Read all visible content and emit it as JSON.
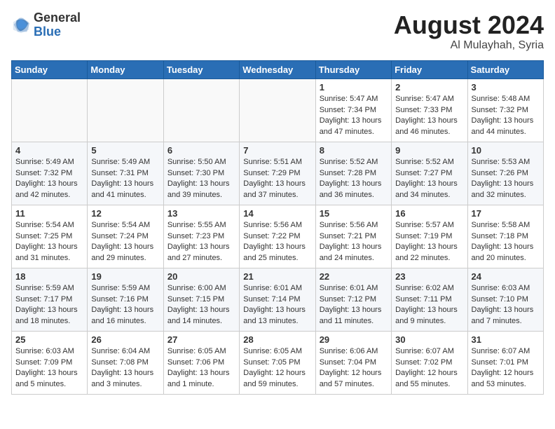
{
  "header": {
    "logo_general": "General",
    "logo_blue": "Blue",
    "month_year": "August 2024",
    "location": "Al Mulayhah, Syria"
  },
  "weekdays": [
    "Sunday",
    "Monday",
    "Tuesday",
    "Wednesday",
    "Thursday",
    "Friday",
    "Saturday"
  ],
  "weeks": [
    [
      {
        "day": "",
        "info": ""
      },
      {
        "day": "",
        "info": ""
      },
      {
        "day": "",
        "info": ""
      },
      {
        "day": "",
        "info": ""
      },
      {
        "day": "1",
        "info": "Sunrise: 5:47 AM\nSunset: 7:34 PM\nDaylight: 13 hours\nand 47 minutes."
      },
      {
        "day": "2",
        "info": "Sunrise: 5:47 AM\nSunset: 7:33 PM\nDaylight: 13 hours\nand 46 minutes."
      },
      {
        "day": "3",
        "info": "Sunrise: 5:48 AM\nSunset: 7:32 PM\nDaylight: 13 hours\nand 44 minutes."
      }
    ],
    [
      {
        "day": "4",
        "info": "Sunrise: 5:49 AM\nSunset: 7:32 PM\nDaylight: 13 hours\nand 42 minutes."
      },
      {
        "day": "5",
        "info": "Sunrise: 5:49 AM\nSunset: 7:31 PM\nDaylight: 13 hours\nand 41 minutes."
      },
      {
        "day": "6",
        "info": "Sunrise: 5:50 AM\nSunset: 7:30 PM\nDaylight: 13 hours\nand 39 minutes."
      },
      {
        "day": "7",
        "info": "Sunrise: 5:51 AM\nSunset: 7:29 PM\nDaylight: 13 hours\nand 37 minutes."
      },
      {
        "day": "8",
        "info": "Sunrise: 5:52 AM\nSunset: 7:28 PM\nDaylight: 13 hours\nand 36 minutes."
      },
      {
        "day": "9",
        "info": "Sunrise: 5:52 AM\nSunset: 7:27 PM\nDaylight: 13 hours\nand 34 minutes."
      },
      {
        "day": "10",
        "info": "Sunrise: 5:53 AM\nSunset: 7:26 PM\nDaylight: 13 hours\nand 32 minutes."
      }
    ],
    [
      {
        "day": "11",
        "info": "Sunrise: 5:54 AM\nSunset: 7:25 PM\nDaylight: 13 hours\nand 31 minutes."
      },
      {
        "day": "12",
        "info": "Sunrise: 5:54 AM\nSunset: 7:24 PM\nDaylight: 13 hours\nand 29 minutes."
      },
      {
        "day": "13",
        "info": "Sunrise: 5:55 AM\nSunset: 7:23 PM\nDaylight: 13 hours\nand 27 minutes."
      },
      {
        "day": "14",
        "info": "Sunrise: 5:56 AM\nSunset: 7:22 PM\nDaylight: 13 hours\nand 25 minutes."
      },
      {
        "day": "15",
        "info": "Sunrise: 5:56 AM\nSunset: 7:21 PM\nDaylight: 13 hours\nand 24 minutes."
      },
      {
        "day": "16",
        "info": "Sunrise: 5:57 AM\nSunset: 7:19 PM\nDaylight: 13 hours\nand 22 minutes."
      },
      {
        "day": "17",
        "info": "Sunrise: 5:58 AM\nSunset: 7:18 PM\nDaylight: 13 hours\nand 20 minutes."
      }
    ],
    [
      {
        "day": "18",
        "info": "Sunrise: 5:59 AM\nSunset: 7:17 PM\nDaylight: 13 hours\nand 18 minutes."
      },
      {
        "day": "19",
        "info": "Sunrise: 5:59 AM\nSunset: 7:16 PM\nDaylight: 13 hours\nand 16 minutes."
      },
      {
        "day": "20",
        "info": "Sunrise: 6:00 AM\nSunset: 7:15 PM\nDaylight: 13 hours\nand 14 minutes."
      },
      {
        "day": "21",
        "info": "Sunrise: 6:01 AM\nSunset: 7:14 PM\nDaylight: 13 hours\nand 13 minutes."
      },
      {
        "day": "22",
        "info": "Sunrise: 6:01 AM\nSunset: 7:12 PM\nDaylight: 13 hours\nand 11 minutes."
      },
      {
        "day": "23",
        "info": "Sunrise: 6:02 AM\nSunset: 7:11 PM\nDaylight: 13 hours\nand 9 minutes."
      },
      {
        "day": "24",
        "info": "Sunrise: 6:03 AM\nSunset: 7:10 PM\nDaylight: 13 hours\nand 7 minutes."
      }
    ],
    [
      {
        "day": "25",
        "info": "Sunrise: 6:03 AM\nSunset: 7:09 PM\nDaylight: 13 hours\nand 5 minutes."
      },
      {
        "day": "26",
        "info": "Sunrise: 6:04 AM\nSunset: 7:08 PM\nDaylight: 13 hours\nand 3 minutes."
      },
      {
        "day": "27",
        "info": "Sunrise: 6:05 AM\nSunset: 7:06 PM\nDaylight: 13 hours\nand 1 minute."
      },
      {
        "day": "28",
        "info": "Sunrise: 6:05 AM\nSunset: 7:05 PM\nDaylight: 12 hours\nand 59 minutes."
      },
      {
        "day": "29",
        "info": "Sunrise: 6:06 AM\nSunset: 7:04 PM\nDaylight: 12 hours\nand 57 minutes."
      },
      {
        "day": "30",
        "info": "Sunrise: 6:07 AM\nSunset: 7:02 PM\nDaylight: 12 hours\nand 55 minutes."
      },
      {
        "day": "31",
        "info": "Sunrise: 6:07 AM\nSunset: 7:01 PM\nDaylight: 12 hours\nand 53 minutes."
      }
    ]
  ]
}
